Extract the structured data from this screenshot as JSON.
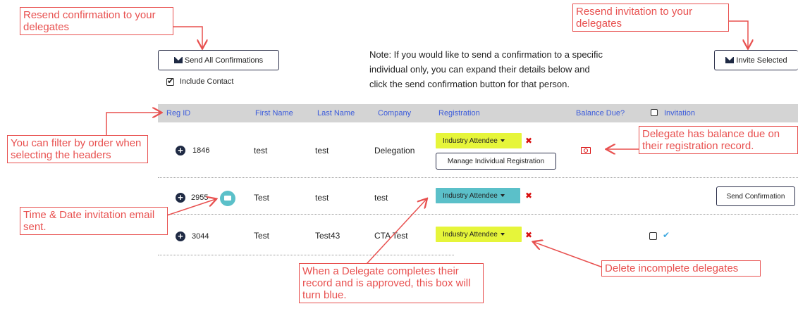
{
  "toolbar": {
    "send_all_label": "Send All Confirmations",
    "include_contact_label": "Include Contact",
    "include_contact_checked": true,
    "invite_selected_label": "Invite Selected"
  },
  "note": {
    "line1": "Note: If you would like to send a confirmation to a specific",
    "line2": "individual only, you can expand their details below and",
    "line3": "click the send confirmation button for that person."
  },
  "table": {
    "headers": {
      "reg_id": "Reg ID",
      "first_name": "First Name",
      "last_name": "Last Name",
      "company": "Company",
      "registration": "Registration",
      "balance_due": "Balance Due?",
      "invitation": "Invitation"
    },
    "rows": [
      {
        "reg_id": "1846",
        "first_name": "test",
        "last_name": "test",
        "company": "Delegation",
        "registration": "Industry Attendee",
        "registration_status": "incomplete",
        "manage_label": "Manage Individual Registration"
      },
      {
        "reg_id": "2955",
        "first_name": "Test",
        "last_name": "test",
        "company": "test",
        "registration": "Industry Attendee",
        "registration_status": "approved",
        "send_confirmation_label": "Send Confirmation"
      },
      {
        "reg_id": "3044",
        "first_name": "Test",
        "last_name": "Test43",
        "company": "CTA Test",
        "registration": "Industry Attendee",
        "registration_status": "incomplete"
      }
    ]
  },
  "annotations": {
    "resend_confirmation": "Resend confirmation to your delegates",
    "resend_invitation": "Resend invitation to your delegates",
    "filter_by_order": "You can filter by order when selecting the headers",
    "balance_due": "Delegate has balance due on their registration record.",
    "time_date_invitation": "Time & Date invitation email sent.",
    "turns_blue": "When a Delegate completes their record and is approved, this box will turn blue.",
    "delete_incomplete": "Delete incomplete delegates"
  },
  "colors": {
    "incomplete_badge": "#e6f53a",
    "approved_badge": "#5bc0c9",
    "annotation": "#e8504f",
    "header_text": "#3b5bdb",
    "delete": "#d90f0f"
  }
}
